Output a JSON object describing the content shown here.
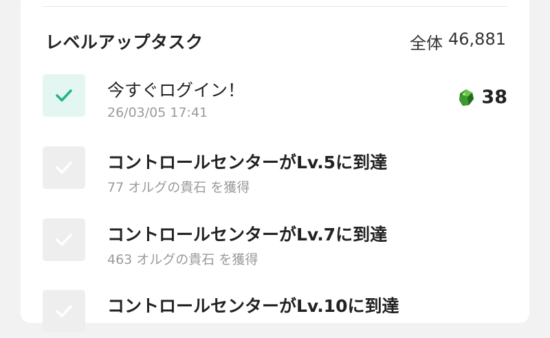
{
  "header": {
    "title": "レベルアップタスク",
    "total_label": "全体",
    "total_value": "46,881"
  },
  "tasks": [
    {
      "title": "今すぐログイン！",
      "subtitle": "26/03/05 17:41",
      "completed": true,
      "reward_value": "38",
      "reward_icon": "green-gem-icon"
    },
    {
      "title": "コントロールセンターがLv.5に到達",
      "subtitle": "77 オルグの貴石 を獲得",
      "completed": false
    },
    {
      "title": "コントロールセンターがLv.7に到達",
      "subtitle": "463 オルグの貴石 を獲得",
      "completed": false
    },
    {
      "title": "コントロールセンターがLv.10に到達",
      "completed": false
    }
  ],
  "colors": {
    "check_done": "#1fb38a",
    "check_done_bg": "#e3f6f2",
    "check_todo": "#ffffff",
    "check_todo_bg": "#eeeeee",
    "gem": "#3d9a2e"
  }
}
